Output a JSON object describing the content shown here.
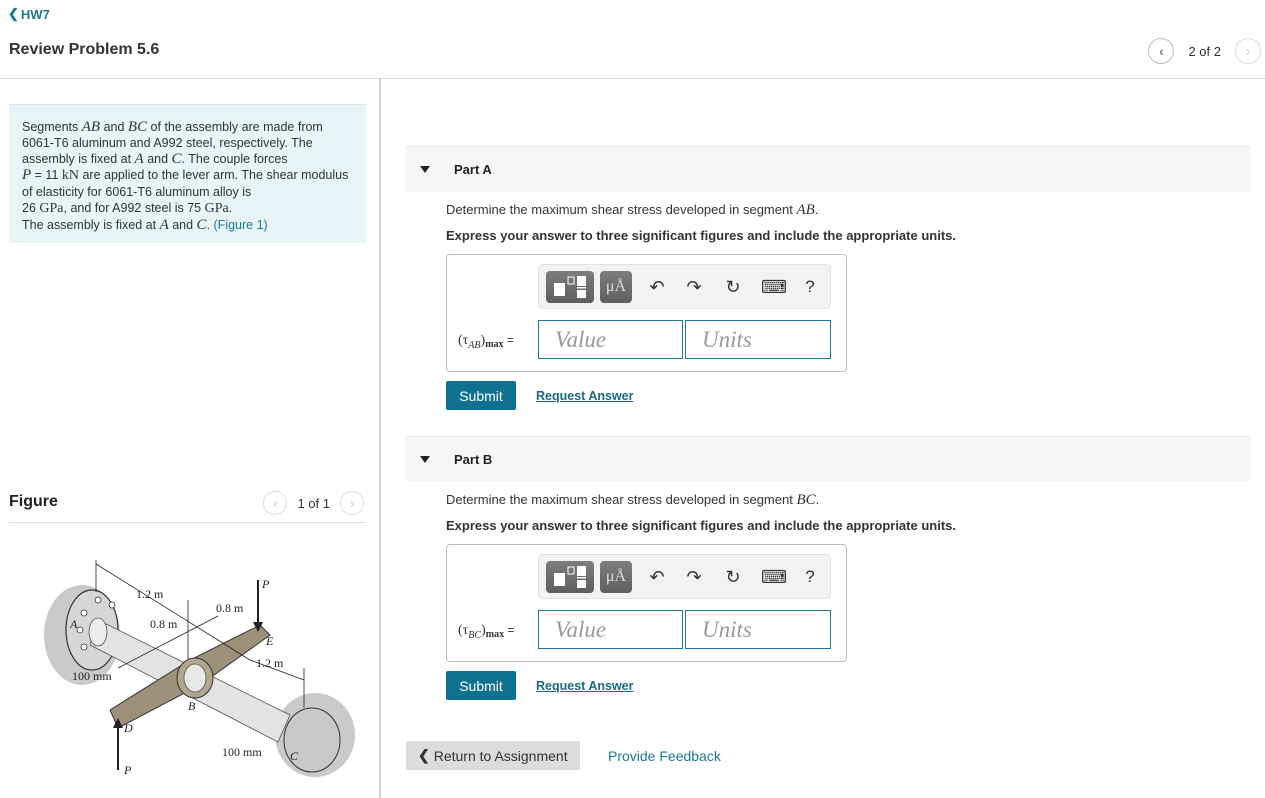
{
  "header": {
    "back_label": "HW7",
    "title": "Review Problem 5.6",
    "pager": {
      "count": "2 of 2"
    }
  },
  "intro": {
    "line1_pre": "Segments ",
    "seg1": "AB",
    "line1_mid": " and ",
    "seg2": "BC",
    "line1_post": " of the assembly are made from 6061-T6 aluminum and A992 steel, respectively. The assembly is fixed at ",
    "ptA": "A",
    "and1": " and ",
    "ptC": "C",
    "couple": ". The couple forces ",
    "P": "P",
    "p_eq": " = 11 ",
    "p_unit": "kN",
    "shear": " are applied to the lever arm. The shear modulus of elasticity for 6061-T6 aluminum alloy is ",
    "g1": "26 ",
    "g1_unit": "GPa",
    "steel": ", and for A992 steel is 75 ",
    "g2_unit": "GPa",
    "period": ".",
    "fixed_pre": "The assembly is fixed at ",
    "ptA2": "A",
    "and2": " and ",
    "ptC2": "C",
    "fixed_post": ". ",
    "figure_link": "(Figure 1)"
  },
  "figure": {
    "label": "Figure",
    "count": "1 of 1",
    "labels": {
      "A": "A",
      "B": "B",
      "C": "C",
      "D": "D",
      "E": "E",
      "P": "P",
      "dim_1_2a": "1.2 m",
      "dim_0_8a": "0.8 m",
      "dim_0_8b": "0.8 m",
      "dim_1_2b": "1.2 m",
      "dim_100a": "100 mm",
      "dim_100b": "100 mm"
    }
  },
  "parts": [
    {
      "title": "Part A",
      "question_pre": "Determine the maximum shear stress developed in segment ",
      "question_seg": "AB",
      "question_post": ".",
      "instruction": "Express your answer to three significant figures and include the appropriate units.",
      "var_tau": "(τ",
      "var_sub": "AB",
      "var_close": ")",
      "var_max": "max",
      "var_eq": " =",
      "value_placeholder": "Value",
      "units_placeholder": "Units",
      "submit": "Submit",
      "request": "Request Answer"
    },
    {
      "title": "Part B",
      "question_pre": "Determine the maximum shear stress developed in segment ",
      "question_seg": "BC",
      "question_post": ".",
      "instruction": "Express your answer to three significant figures and include the appropriate units.",
      "var_tau": "(τ",
      "var_sub": "BC",
      "var_close": ")",
      "var_max": "max",
      "var_eq": " =",
      "value_placeholder": "Value",
      "units_placeholder": "Units",
      "submit": "Submit",
      "request": "Request Answer"
    }
  ],
  "toolbar": {
    "units_glyph": "μÅ",
    "undo": "↶",
    "redo": "↷",
    "reset": "↻",
    "keyboard": "⌨",
    "help": "?"
  },
  "footer": {
    "return_label": "Return to Assignment",
    "feedback_label": "Provide Feedback"
  }
}
